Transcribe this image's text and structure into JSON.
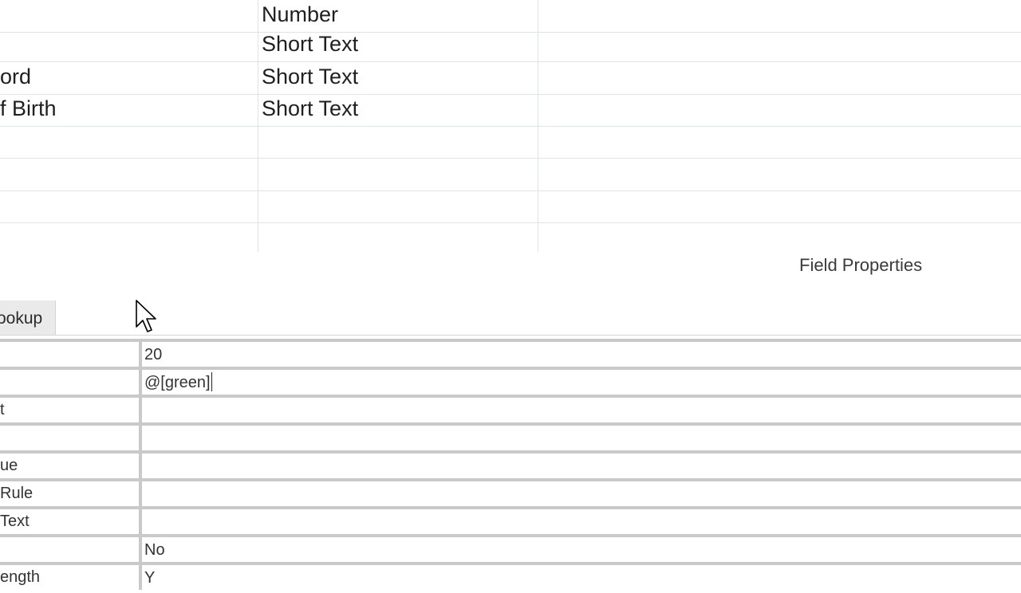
{
  "table_design": {
    "rows": [
      {
        "field_name": "",
        "data_type": "Number",
        "description": ""
      },
      {
        "field_name": "",
        "data_type": "Short Text",
        "description": ""
      },
      {
        "field_name": "ord",
        "data_type": "Short Text",
        "description": ""
      },
      {
        "field_name": "f Birth",
        "data_type": "Short Text",
        "description": ""
      },
      {
        "field_name": "",
        "data_type": "",
        "description": ""
      },
      {
        "field_name": "",
        "data_type": "",
        "description": ""
      },
      {
        "field_name": "",
        "data_type": "",
        "description": ""
      },
      {
        "field_name": "",
        "data_type": "",
        "description": ""
      }
    ]
  },
  "field_properties": {
    "title": "Field Properties",
    "tab_lookup_label": "ookup",
    "properties": [
      {
        "label": "",
        "value": "20"
      },
      {
        "label": "",
        "value": "@[green]"
      },
      {
        "label": "t",
        "value": ""
      },
      {
        "label": "",
        "value": ""
      },
      {
        "label": "ue",
        "value": ""
      },
      {
        "label": "Rule",
        "value": ""
      },
      {
        "label": "Text",
        "value": ""
      },
      {
        "label": "",
        "value": "No"
      },
      {
        "label": "ength",
        "value": "Y"
      }
    ]
  },
  "cursor_icon": "mouse-pointer-icon"
}
